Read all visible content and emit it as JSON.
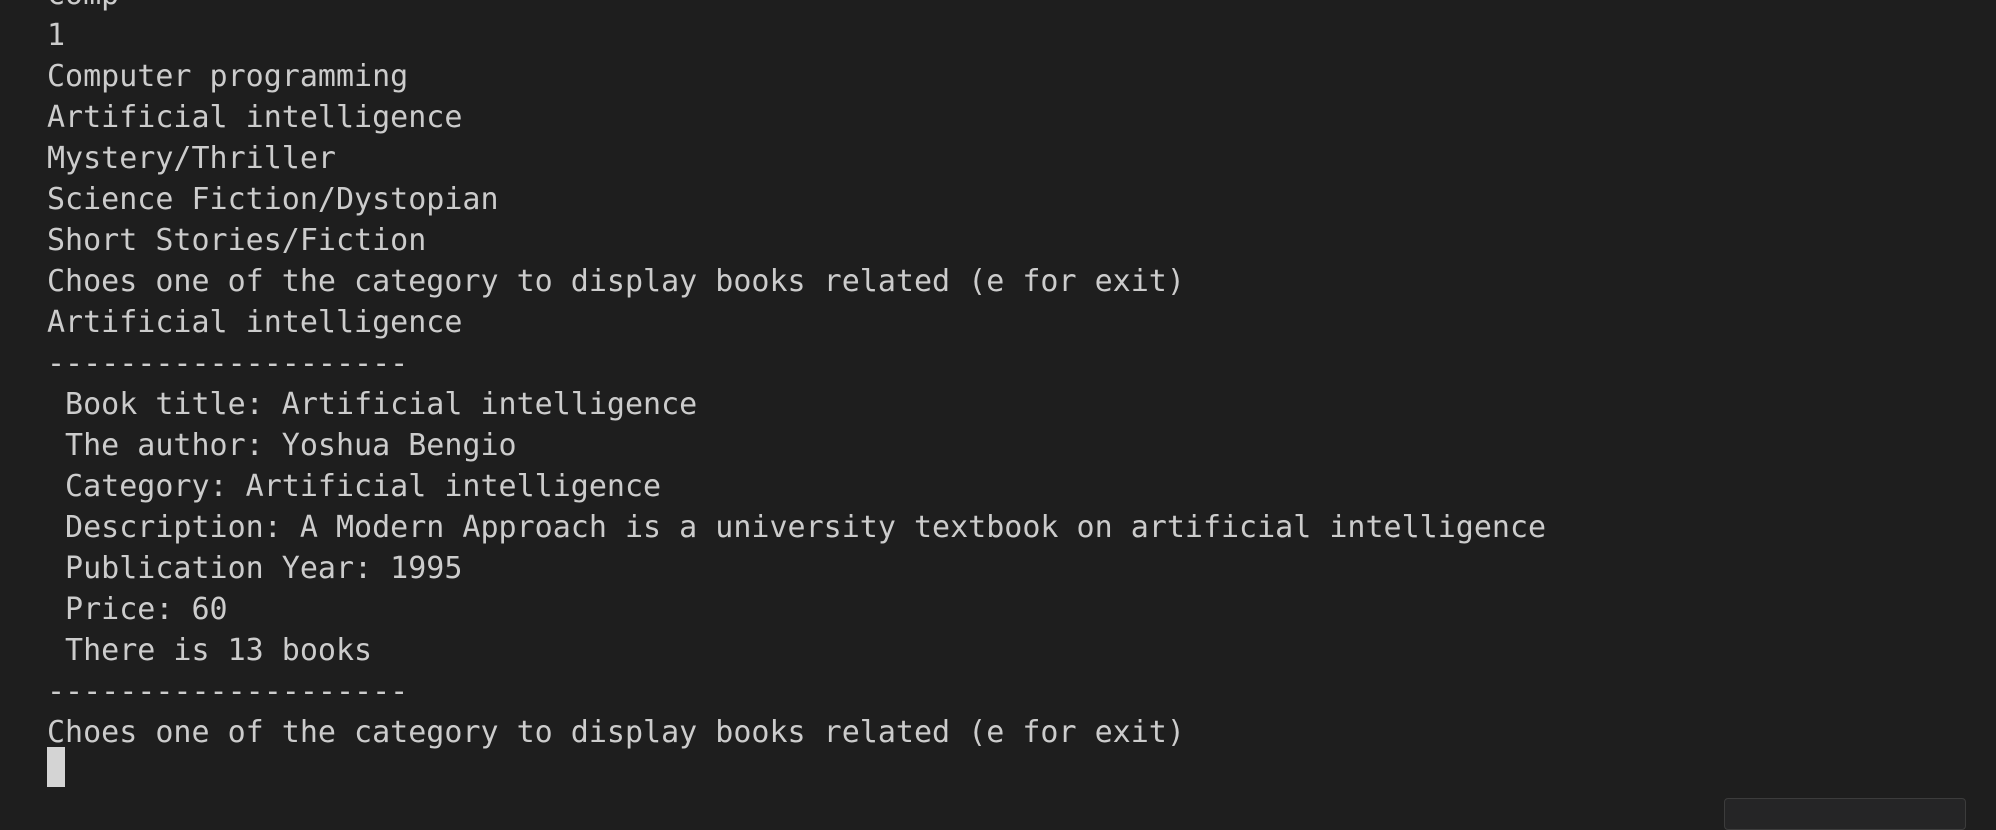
{
  "terminal": {
    "lines": [
      "Comp",
      "1",
      "Computer programming",
      "Artificial intelligence",
      "Mystery/Thriller",
      "Science Fiction/Dystopian",
      "Short Stories/Fiction",
      "Choes one of the category to display books related (e for exit)",
      "Artificial intelligence",
      "--------------------",
      " Book title: Artificial intelligence",
      " The author: Yoshua Bengio",
      " Category: Artificial intelligence",
      " Description: A Modern Approach is a university textbook on artificial intelligence",
      " Publication Year: 1995",
      " Price: 60",
      " There is 13 books",
      "--------------------",
      "Choes one of the category to display books related (e for exit)"
    ]
  }
}
